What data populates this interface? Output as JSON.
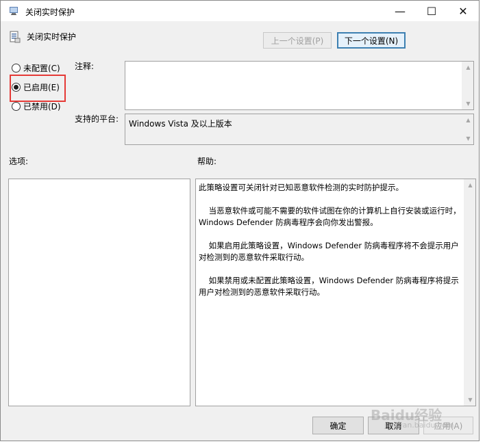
{
  "window": {
    "title": "关闭实时保护",
    "minimize": "—",
    "maximize": "☐",
    "close": "✕"
  },
  "header": {
    "title": "关闭实时保护",
    "prev_setting": "上一个设置(P)",
    "next_setting": "下一个设置(N)"
  },
  "radios": [
    {
      "label": "未配置(C)",
      "checked": false
    },
    {
      "label": "已启用(E)",
      "checked": true
    },
    {
      "label": "已禁用(D)",
      "checked": false
    }
  ],
  "comment": {
    "label": "注释:",
    "value": ""
  },
  "platform": {
    "label": "支持的平台:",
    "value": "Windows Vista 及以上版本"
  },
  "options": {
    "label": "选项:"
  },
  "help": {
    "label": "帮助:",
    "paragraphs": [
      "此策略设置可关闭针对已知恶意软件检测的实时防护提示。",
      "    当恶意软件或可能不需要的软件试图在你的计算机上自行安装或运行时，Windows Defender 防病毒程序会向你发出警报。",
      "    如果启用此策略设置，Windows Defender 防病毒程序将不会提示用户对检测到的恶意软件采取行动。",
      "    如果禁用或未配置此策略设置，Windows Defender 防病毒程序将提示用户对检测到的恶意软件采取行动。"
    ]
  },
  "buttons": {
    "ok": "确定",
    "cancel": "取消",
    "apply": "应用(A)"
  },
  "watermark": {
    "text": "Baidu经验",
    "sub": "jingyan.baidu.com"
  },
  "colors": {
    "highlight": "#e53935",
    "accent": "#3c7fb1"
  }
}
